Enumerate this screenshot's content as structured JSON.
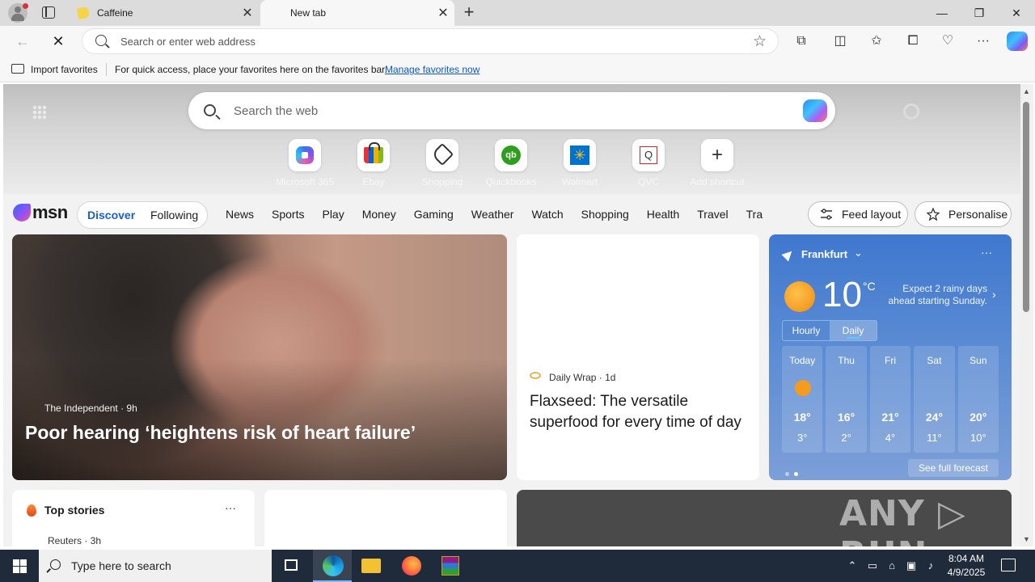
{
  "browser": {
    "tabs": [
      {
        "title": "Caffeine",
        "active": false
      },
      {
        "title": "New tab",
        "active": true
      }
    ],
    "new_tab_symbol": "+",
    "window_controls": {
      "minimize": "—",
      "restore": "❐",
      "close": "✕"
    },
    "address_placeholder": "Search or enter web address",
    "nav_icons": [
      "back-icon",
      "stop-loading-icon",
      "extensions-icon",
      "split-screen-icon",
      "favorites-icon",
      "collections-icon",
      "browser-essentials-icon",
      "more-icon",
      "copilot-icon"
    ]
  },
  "favbar": {
    "import_label": "Import favorites",
    "message": "For quick access, place your favorites here on the favorites bar.",
    "manage_link": "Manage favorites now"
  },
  "newtab": {
    "search_placeholder": "Search the web",
    "shortcuts": [
      {
        "label": "Microsoft 365",
        "icon": "microsoft-365-icon"
      },
      {
        "label": "Ebay",
        "icon": "ebay-icon"
      },
      {
        "label": "Shopping",
        "icon": "tag-icon"
      },
      {
        "label": "Quickbooks",
        "icon": "quickbooks-icon",
        "glyph": "qb"
      },
      {
        "label": "Walmart",
        "icon": "walmart-icon",
        "glyph": "✳"
      },
      {
        "label": "QVC",
        "icon": "qvc-icon",
        "glyph": "Q"
      },
      {
        "label": "Add shortcut",
        "icon": "plus-icon",
        "glyph": "+"
      }
    ]
  },
  "msn": {
    "logo_text": "msn",
    "segments": [
      "Discover",
      "Following"
    ],
    "nav": [
      "News",
      "Sports",
      "Play",
      "Money",
      "Gaming",
      "Weather",
      "Watch",
      "Shopping",
      "Health",
      "Travel",
      "Tra"
    ],
    "feed_layout": "Feed layout",
    "personalise": "Personalise"
  },
  "hero": {
    "source": "The Independent · 9h",
    "headline": "Poor hearing ‘heightens risk of heart failure’"
  },
  "article": {
    "source": "Daily Wrap · 1d",
    "headline": "Flaxseed: The versatile superfood for every time of day"
  },
  "weather": {
    "location": "Frankfurt",
    "temp": "10",
    "unit": "°C",
    "note": "Expect 2 rainy days ahead starting Sunday.",
    "tabs": [
      "Hourly",
      "Daily"
    ],
    "selected_tab": "Daily",
    "days": [
      {
        "name": "Today",
        "hi": "18°",
        "lo": "3°"
      },
      {
        "name": "Thu",
        "hi": "16°",
        "lo": "2°"
      },
      {
        "name": "Fri",
        "hi": "21°",
        "lo": "4°"
      },
      {
        "name": "Sat",
        "hi": "24°",
        "lo": "11°"
      },
      {
        "name": "Sun",
        "hi": "20°",
        "lo": "10°"
      }
    ],
    "full_forecast": "See full forecast",
    "more": "···"
  },
  "top_stories": {
    "title": "Top stories",
    "more": "···",
    "first_source": "Reuters · 3h"
  },
  "watermark": "ANY ▷ RUN",
  "taskbar": {
    "search_placeholder": "Type here to search",
    "time": "8:04 AM",
    "date": "4/9/2025"
  }
}
